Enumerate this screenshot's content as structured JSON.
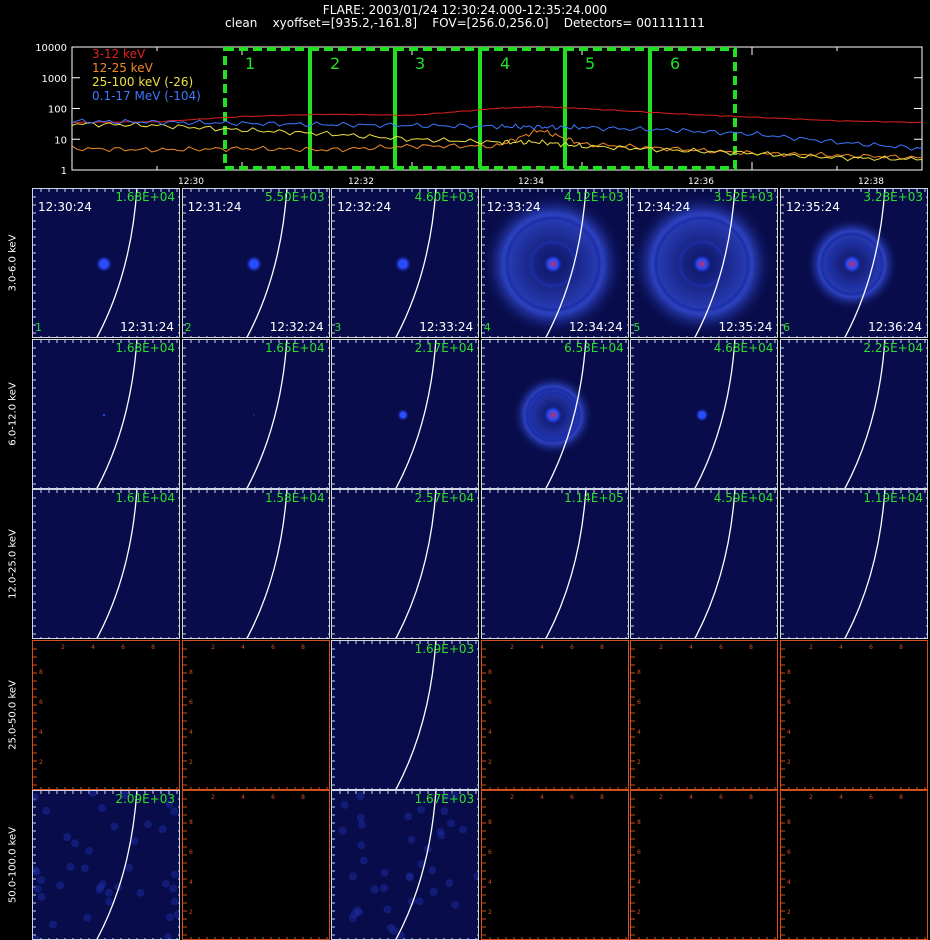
{
  "header": {
    "line1": "FLARE: 2003/01/24 12:30:24.000-12:35:24.000",
    "line2": "clean    xyoffset=[935.2,-161.8]    FOV=[256.0,256.0]    Detectors= 001111111"
  },
  "chart_data": [
    {
      "type": "line",
      "y_scale": "log",
      "ylim": [
        1,
        10000
      ],
      "y_ticks": [
        "10000",
        "1000",
        "100",
        "10",
        "1"
      ],
      "x_range": [
        "12:28:36",
        "12:38:36"
      ],
      "x_ticks": [
        "12:30",
        "12:32",
        "12:34",
        "12:36",
        "12:38"
      ],
      "grid": false,
      "legend": "top-left",
      "series": [
        {
          "name": "3-12 keV",
          "color": "#e02020",
          "t": [
            "12:28:36",
            "12:29:36",
            "12:30:36",
            "12:31:36",
            "12:32:36",
            "12:33:36",
            "12:34:06",
            "12:34:36",
            "12:35:36",
            "12:36:36",
            "12:37:36",
            "12:38:36"
          ],
          "y": [
            35,
            37,
            55,
            65,
            60,
            100,
            115,
            100,
            70,
            52,
            40,
            35
          ]
        },
        {
          "name": "12-25 keV",
          "color": "#f08a2a",
          "t": [
            "12:28:36",
            "12:29:36",
            "12:30:36",
            "12:31:36",
            "12:32:36",
            "12:33:36",
            "12:34:06",
            "12:34:36",
            "12:35:36",
            "12:36:36",
            "12:37:36",
            "12:38:36"
          ],
          "y": [
            5,
            4.5,
            5,
            4.5,
            6,
            6,
            20,
            7,
            5,
            3.5,
            3,
            2.5
          ]
        },
        {
          "name": "25-100 keV (-26)",
          "color": "#f0e040",
          "t": [
            "12:28:36",
            "12:29:36",
            "12:30:36",
            "12:31:36",
            "12:32:36",
            "12:33:36",
            "12:34:06",
            "12:34:36",
            "12:35:36",
            "12:36:36",
            "12:37:36",
            "12:38:36"
          ],
          "y": [
            32,
            28,
            20,
            15,
            10,
            8,
            8,
            6,
            4.5,
            3.5,
            2.5,
            2.2
          ]
        },
        {
          "name": "0.1-17 MeV (-104)",
          "color": "#3c78ff",
          "t": [
            "12:28:36",
            "12:29:36",
            "12:30:36",
            "12:31:36",
            "12:32:36",
            "12:33:36",
            "12:34:06",
            "12:34:36",
            "12:35:36",
            "12:36:36",
            "12:37:36",
            "12:38:36"
          ],
          "y": [
            38,
            36,
            33,
            30,
            28,
            26,
            25,
            24,
            20,
            15,
            8,
            5
          ]
        }
      ],
      "annotations": [
        {
          "label": "1",
          "t_start": "12:30:24",
          "t_end": "12:31:24"
        },
        {
          "label": "2",
          "t_start": "12:31:24",
          "t_end": "12:32:24"
        },
        {
          "label": "3",
          "t_start": "12:32:24",
          "t_end": "12:33:24"
        },
        {
          "label": "4",
          "t_start": "12:33:24",
          "t_end": "12:34:24"
        },
        {
          "label": "5",
          "t_start": "12:34:24",
          "t_end": "12:35:24"
        },
        {
          "label": "6",
          "t_start": "12:35:24",
          "t_end": "12:36:24"
        }
      ]
    },
    {
      "type": "heatmap",
      "rows": [
        "3.0-6.0 keV",
        "6.0-12.0 keV",
        "12.0-25.0 keV",
        "25.0-50.0 keV",
        "50.0-100.0 keV"
      ],
      "columns": [
        {
          "index": "1",
          "start": "12:30:24",
          "end": "12:31:24"
        },
        {
          "index": "2",
          "start": "12:31:24",
          "end": "12:32:24"
        },
        {
          "index": "3",
          "start": "12:32:24",
          "end": "12:33:24"
        },
        {
          "index": "4",
          "start": "12:33:24",
          "end": "12:34:24"
        },
        {
          "index": "5",
          "start": "12:34:24",
          "end": "12:35:24"
        },
        {
          "index": "6",
          "start": "12:35:24",
          "end": "12:36:24"
        }
      ],
      "peak_values": [
        [
          "1.68E+04",
          "5.50E+03",
          "4.60E+03",
          "4.12E+03",
          "3.52E+03",
          "3.28E+03"
        ],
        [
          "1.68E+04",
          "1.65E+04",
          "2.17E+04",
          "6.53E+04",
          "4.68E+04",
          "2.25E+04"
        ],
        [
          "1.61E+04",
          "1.58E+04",
          "2.57E+04",
          "1.14E+05",
          "4.59E+04",
          "1.19E+04"
        ],
        [
          null,
          null,
          "1.69E+03",
          null,
          null,
          null
        ],
        [
          "2.09E+03",
          null,
          "1.67E+03",
          null,
          null,
          null
        ]
      ],
      "empty_axis_ticks": [
        "2",
        "4",
        "6",
        "8"
      ]
    }
  ]
}
